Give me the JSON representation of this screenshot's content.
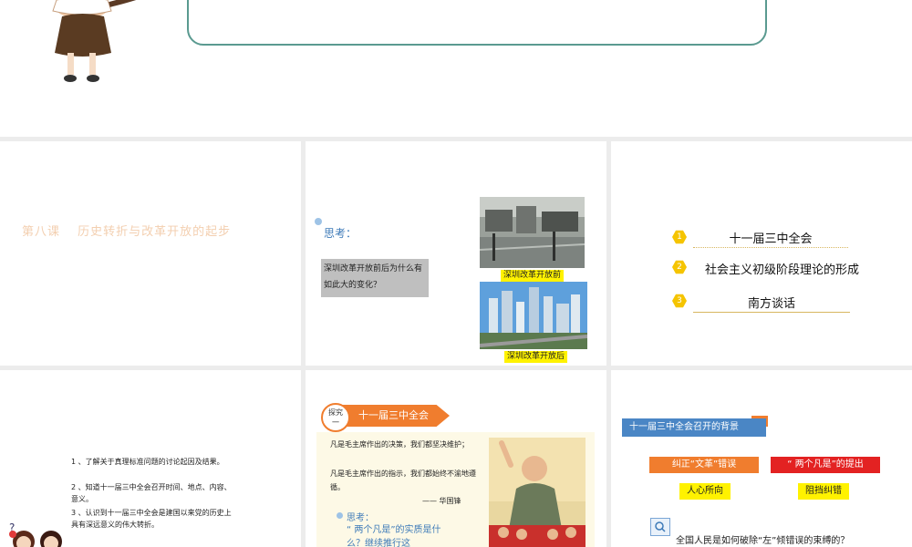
{
  "slide1": {
    "cartoon": "teacher-character"
  },
  "slide2": {
    "title": "第八课　 历史转折与改革开放的起步"
  },
  "slide3": {
    "think_label": "思考：",
    "question": "深圳改革开放前后为什么有如此大的变化？",
    "caption_before": "深圳改革开放前",
    "caption_after": "深圳改革开放后"
  },
  "slide4": {
    "items": [
      {
        "num": "1",
        "label": "十一届三中全会"
      },
      {
        "num": "2",
        "label": "社会主义初级阶段理论的形成"
      },
      {
        "num": "3",
        "label": "南方谈话"
      }
    ]
  },
  "slide5": {
    "objectives": [
      "1 、了解关于真理标准问题的讨论起因及结果。",
      "2 、知道十一届三中全会召开时间、地点、内容、意义。",
      "3 、认识到十一届三中全会是建国以来党的历史上具有深远意义的伟大转折。"
    ],
    "question_mark": "?"
  },
  "slide6": {
    "badge": "探究一",
    "badge_line1": "探究",
    "badge_line2": "一",
    "heading": "十一届三中全会",
    "quote_line1": "凡是毛主席作出的决策，我们都坚决维护；",
    "quote_line2": "凡是毛主席作出的指示，我们都始终不渝地遵循。",
    "attribution": "—— 华国锋",
    "think_label": "思考：",
    "think_text": "“ 两个凡是”的实质是什么？继续推行这"
  },
  "slide7": {
    "header": "十一届三中全会召开的背景",
    "left_red": "纠正“文革”错误",
    "right_red": "“ 两个凡是”的提出",
    "left_yellow": "人心所向",
    "right_yellow": "阻挡纠错",
    "question": "全国人民是如何破除“左”倾错误的束缚的？"
  },
  "colors": {
    "orange": "#f07d2e",
    "red": "#e32222",
    "yellow": "#fff200",
    "blue_header": "#4a86c5",
    "teal_border": "#5a9a90"
  }
}
